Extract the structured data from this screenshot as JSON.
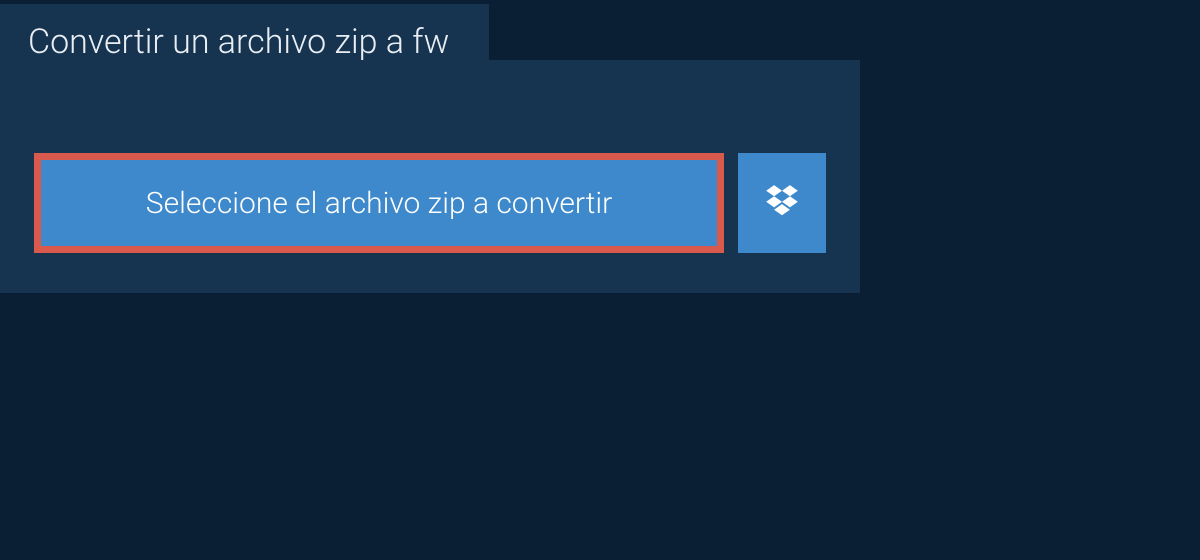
{
  "header": {
    "title": "Convertir un archivo zip a fw"
  },
  "actions": {
    "select_label": "Seleccione el archivo zip a convertir",
    "dropbox_icon": "dropbox-icon"
  },
  "colors": {
    "background": "#0a1f33",
    "panel": "#163450",
    "button": "#3d89cc",
    "highlight_border": "#d9594c",
    "text": "#ffffff"
  }
}
